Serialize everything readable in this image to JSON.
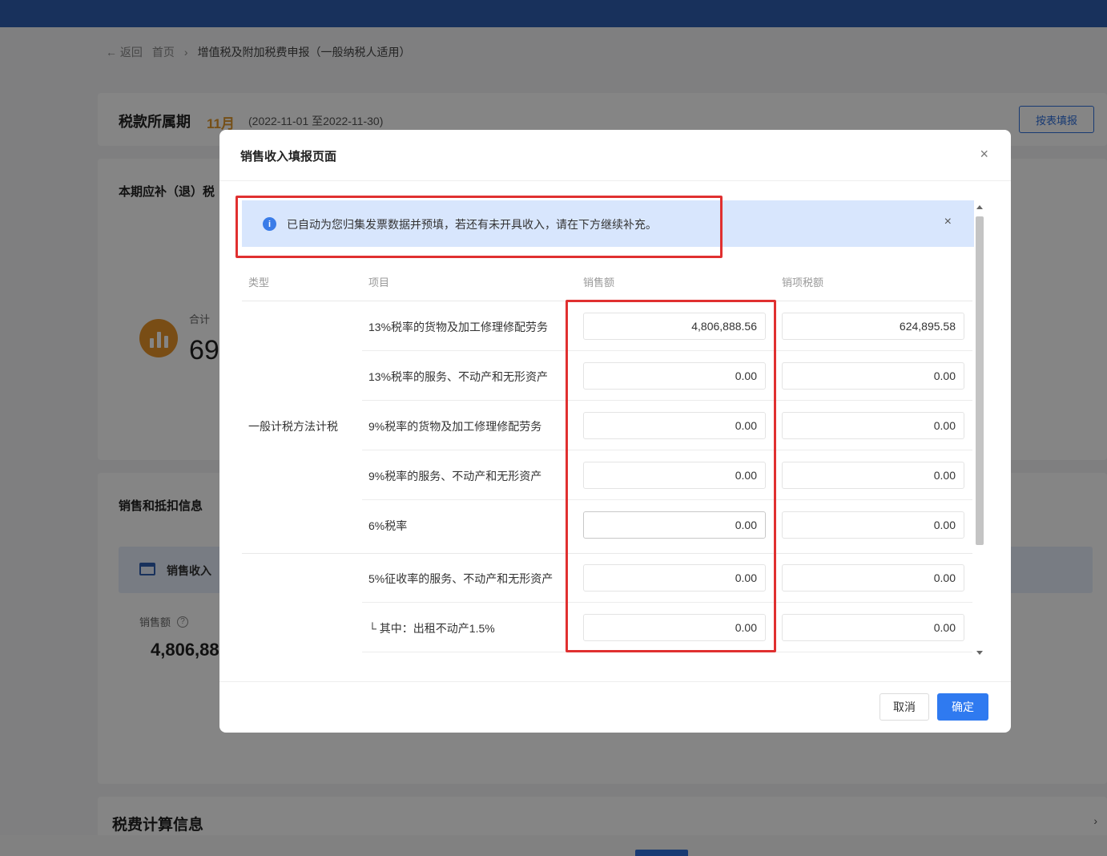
{
  "background": {
    "breadcrumb": {
      "back": "← 返回",
      "home": "首页",
      "separator": "›",
      "current": "增值税及附加税费申报（一般纳税人适用）"
    },
    "period": {
      "title": "税款所属期",
      "month": "11月",
      "range": "(2022-11-01 至2022-11-30)",
      "button": "按表填报"
    },
    "due_section": {
      "title": "本期应补（退）税",
      "sum_label": "合计",
      "sum_value_partial": "69"
    },
    "sales_section": {
      "title": "销售和抵扣信息",
      "band_label": "销售收入",
      "sub_label": "销售额",
      "help_icon": "?",
      "amount_partial": "4,806,88"
    },
    "calc_section": {
      "title": "税费计算信息",
      "chevron": "›"
    }
  },
  "modal": {
    "title": "销售收入填报页面",
    "close": "×",
    "notice": {
      "icon": "i",
      "text": "已自动为您归集发票数据并预填，若还有未开具收入，请在下方继续补充。",
      "close": "×"
    },
    "columns": {
      "type": "类型",
      "item": "项目",
      "sales": "销售额",
      "tax": "销项税额"
    },
    "type_label": "一般计税方法计税",
    "rows": [
      {
        "item": "13%税率的货物及加工修理修配劳务",
        "sales": "4,806,888.56",
        "tax": "624,895.58"
      },
      {
        "item": "13%税率的服务、不动产和无形资产",
        "sales": "0.00",
        "tax": "0.00"
      },
      {
        "item": "9%税率的货物及加工修理修配劳务",
        "sales": "0.00",
        "tax": "0.00"
      },
      {
        "item": "9%税率的服务、不动产和无形资产",
        "sales": "0.00",
        "tax": "0.00"
      },
      {
        "item": "6%税率",
        "sales": "0.00",
        "tax": "0.00"
      },
      {
        "item": "5%征收率的服务、不动产和无形资产",
        "sales": "0.00",
        "tax": "0.00"
      },
      {
        "item": "└ 其中：出租不动产1.5%",
        "sales": "0.00",
        "tax": "0.00"
      }
    ],
    "footer": {
      "cancel": "取消",
      "ok": "确定"
    }
  },
  "colors": {
    "primary": "#2f7af0",
    "highlight_box": "#e03030",
    "notice_bg": "#d8e6fd",
    "period_month": "#e0982c"
  }
}
